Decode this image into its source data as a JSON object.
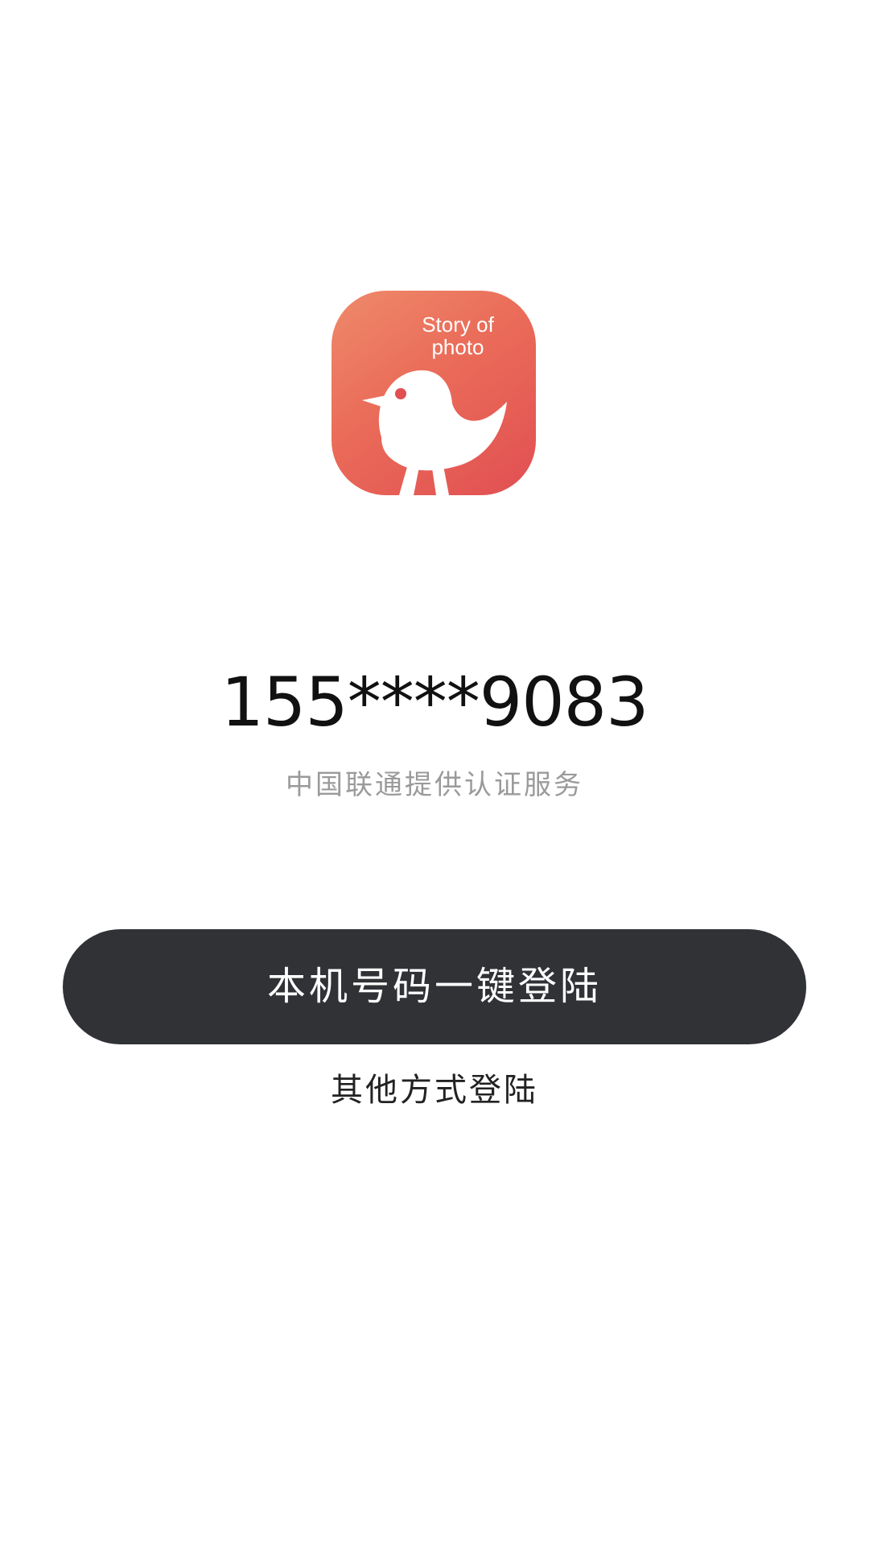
{
  "app_icon": {
    "line1": "Story of",
    "line2": "photo",
    "colors": {
      "gradient_start": "#ee8a6a",
      "gradient_end": "#e14f52",
      "bird": "#ffffff",
      "eye": "#e14f52"
    },
    "icon": "bird-icon"
  },
  "login": {
    "phone_number": "155****9083",
    "provider_note": "中国联通提供认证服务",
    "one_click_label": "本机号码一键登陆",
    "other_methods_label": "其他方式登陆"
  },
  "colors": {
    "button_bg": "#303236",
    "note_text": "#9a9a9a"
  }
}
